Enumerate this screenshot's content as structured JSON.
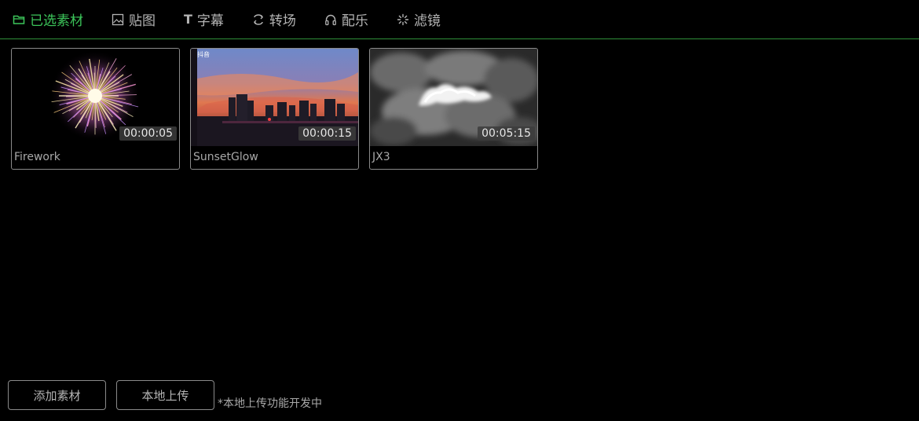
{
  "tabs": [
    {
      "label": "已选素材",
      "icon": "folder-icon",
      "active": true
    },
    {
      "label": "贴图",
      "icon": "image-icon",
      "active": false
    },
    {
      "label": "字幕",
      "icon": "text-t-icon",
      "active": false
    },
    {
      "label": "转场",
      "icon": "transition-icon",
      "active": false
    },
    {
      "label": "配乐",
      "icon": "headphones-icon",
      "active": false
    },
    {
      "label": "滤镜",
      "icon": "sparkle-icon",
      "active": false
    }
  ],
  "text_icon_glyph": "T",
  "colors": {
    "accent": "#3cc55a",
    "divider": "#2f8f3a",
    "background": "#000000"
  },
  "materials": [
    {
      "name": "Firework",
      "duration": "00:00:05",
      "thumbnail": "firework"
    },
    {
      "name": "SunsetGlow",
      "duration": "00:00:15",
      "thumbnail": "sunset-city",
      "watermark": "抖音"
    },
    {
      "name": "JX3",
      "duration": "00:05:15",
      "thumbnail": "smoke"
    }
  ],
  "buttons": {
    "add": "添加素材",
    "upload": "本地上传"
  },
  "note": "*本地上传功能开发中"
}
